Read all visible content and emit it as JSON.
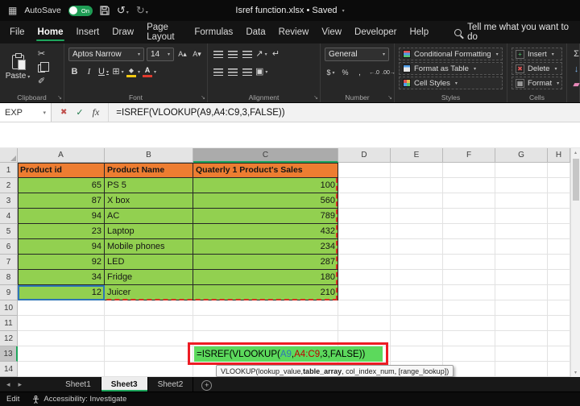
{
  "title_bar": {
    "autosave_label": "AutoSave",
    "autosave_state": "On",
    "document_title": "Isref function.xlsx • Saved"
  },
  "menu": {
    "tabs": [
      "File",
      "Home",
      "Insert",
      "Draw",
      "Page Layout",
      "Formulas",
      "Data",
      "Review",
      "View",
      "Developer",
      "Help"
    ],
    "active_tab": "Home",
    "tell_me": "Tell me what you want to do"
  },
  "ribbon": {
    "clipboard": {
      "label": "Clipboard",
      "paste_label": "Paste"
    },
    "font": {
      "label": "Font",
      "name": "Aptos Narrow",
      "size": "14",
      "bold": "B",
      "italic": "I",
      "underline": "U",
      "grow": "A▴",
      "shrink": "A▾",
      "color_letter": "A"
    },
    "alignment": {
      "label": "Alignment"
    },
    "number": {
      "label": "Number",
      "format": "General"
    },
    "styles": {
      "label": "Styles",
      "items": [
        "Conditional Formatting",
        "Format as Table",
        "Cell Styles"
      ]
    },
    "cells": {
      "label": "Cells",
      "items": [
        "Insert",
        "Delete",
        "Format"
      ]
    }
  },
  "formula_bar": {
    "name_box": "EXP",
    "fx_label": "fx",
    "formula": "=ISREF(VLOOKUP(A9,A4:C9,3,FALSE))"
  },
  "grid": {
    "columns": [
      "A",
      "B",
      "C",
      "D",
      "E",
      "F",
      "G",
      "H"
    ],
    "row_count": 14,
    "active_column": "C",
    "active_row": 13,
    "table": {
      "headers": [
        "Product id",
        "Product Name",
        "Quaterly 1 Product's Sales"
      ],
      "data": [
        [
          65,
          "PS 5",
          100
        ],
        [
          87,
          "X box",
          560
        ],
        [
          94,
          "AC",
          789
        ],
        [
          23,
          "Laptop",
          432
        ],
        [
          94,
          "Mobile phones",
          234
        ],
        [
          92,
          "LED",
          287
        ],
        [
          34,
          "Fridge",
          180
        ],
        [
          12,
          "Juicer",
          210
        ]
      ]
    },
    "editing_cell": {
      "cell": "C13",
      "segments": [
        {
          "text": "=ISREF(VLOOKUP(",
          "color": "#000000"
        },
        {
          "text": "A9",
          "color": "#2E75B6"
        },
        {
          "text": ",",
          "color": "#000000"
        },
        {
          "text": "A4:C9",
          "color": "#C00000"
        },
        {
          "text": ",3,FALSE",
          "color": "#000000"
        },
        {
          "text": "))",
          "color": "#000000"
        }
      ]
    },
    "tooltip": {
      "prefix": "VLOOKUP(lookup_value, ",
      "bold": "table_array",
      "suffix": ", col_index_num, [range_lookup])"
    }
  },
  "sheet_tabs": {
    "tabs": [
      "Sheet1",
      "Sheet3",
      "Sheet2"
    ],
    "active": "Sheet3"
  },
  "status_bar": {
    "mode": "Edit",
    "accessibility": "Accessibility: Investigate"
  },
  "icons": {
    "apps_grid": "▦",
    "undo": "↺",
    "redo": "↻",
    "cut": "✂",
    "format_painter": "✐",
    "borders": "⊞",
    "fill_diamond": "◆",
    "merge": "▣",
    "wrap": "↵",
    "orientation": "↗",
    "currency": "$",
    "percent": "%",
    "comma": ",",
    "increase_decimal": "←.0",
    "decrease_decimal": ".00→",
    "sum": "Σ",
    "fill_down": "↓",
    "eraser": "▰",
    "cancel": "✖",
    "enter": "✓",
    "nav_left": "◂",
    "nav_right": "▸",
    "add_sheet": "+",
    "launcher": "↘",
    "scroll_up": "▴",
    "scroll_down": "▾"
  },
  "colors": {
    "accent_green": "#1EA55C",
    "table_header_fill": "#ED7D31",
    "table_data_fill": "#92D050",
    "editing_highlight": "#5CD95C",
    "annotation_red": "#ED1C24",
    "reference_red": "#D93025",
    "reference_blue": "#2E75B6"
  }
}
